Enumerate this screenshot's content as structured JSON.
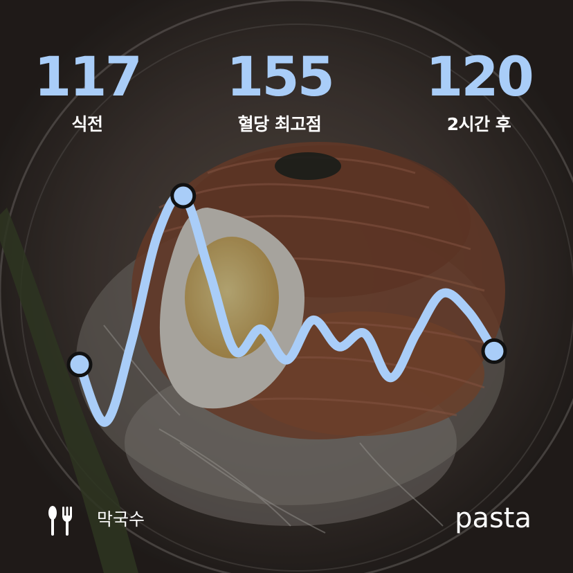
{
  "accent_color": "#a9cdf8",
  "stats": [
    {
      "value": "117",
      "label": "식전"
    },
    {
      "value": "155",
      "label": "혈당 최고점"
    },
    {
      "value": "120",
      "label": "2시간 후"
    }
  ],
  "food": {
    "icon": "fork-knife-icon",
    "name": "막국수"
  },
  "brand": "pasta",
  "chart_data": {
    "type": "line",
    "title": "",
    "xlabel": "",
    "ylabel": "",
    "series": [
      {
        "values": [
          117,
          104,
          122,
          146,
          155,
          138,
          120,
          125,
          118,
          127,
          121,
          124,
          114,
          124,
          133,
          129,
          120
        ]
      }
    ],
    "highlighted_points": [
      "start",
      "peak",
      "end"
    ]
  }
}
